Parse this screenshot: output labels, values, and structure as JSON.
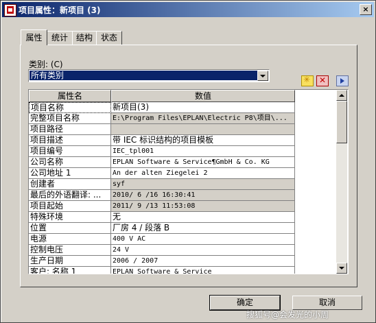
{
  "window": {
    "title": "项目属性：新项目 (3)",
    "close_glyph": "×",
    "icon": "eplan-app-icon"
  },
  "tabs": [
    {
      "label": "属性",
      "active": true
    },
    {
      "label": "统计",
      "active": false
    },
    {
      "label": "结构",
      "active": false
    },
    {
      "label": "状态",
      "active": false
    }
  ],
  "category": {
    "label": "类别: (C)",
    "selected": "所有类别"
  },
  "toolbar": {
    "new_icon": "new-property-icon",
    "delete_icon": "delete-property-icon",
    "next_icon": "arrow-right-icon"
  },
  "grid": {
    "columns": [
      "属性名",
      "数值"
    ],
    "rows": [
      {
        "name": "项目名称",
        "value": "新项目(3)"
      },
      {
        "name": "完整项目名称",
        "value": "E:\\Program Files\\EPLAN\\Electric P8\\项目\\..."
      },
      {
        "name": "项目路径",
        "value": ""
      },
      {
        "name": "项目描述",
        "value": "带 IEC 标识结构的项目模板"
      },
      {
        "name": "项目编号",
        "value": "IEC_tpl001"
      },
      {
        "name": "公司名称",
        "value": "EPLAN Software & Service¶GmbH & Co. KG"
      },
      {
        "name": "公司地址 1",
        "value": "An der alten Ziegelei 2"
      },
      {
        "name": "创建者",
        "value": "syf"
      },
      {
        "name": "最后的外语翻译: ...",
        "value": "2010/ 6 /16 16:30:41"
      },
      {
        "name": "项目起始",
        "value": "2011/ 9 /13 11:53:08"
      },
      {
        "name": "特殊环境",
        "value": "无"
      },
      {
        "name": "位置",
        "value": "厂房 4 / 段落 B"
      },
      {
        "name": "电源",
        "value": "400 V AC"
      },
      {
        "name": "控制电压",
        "value": "24 V"
      },
      {
        "name": "生产日期",
        "value": "2006 / 2007"
      },
      {
        "name": "客户: 名称 1",
        "value": "EPLAN Software & Service"
      }
    ]
  },
  "buttons": {
    "ok": "确定",
    "cancel": "取消"
  },
  "watermark": "搜狐号@会发光的小周"
}
